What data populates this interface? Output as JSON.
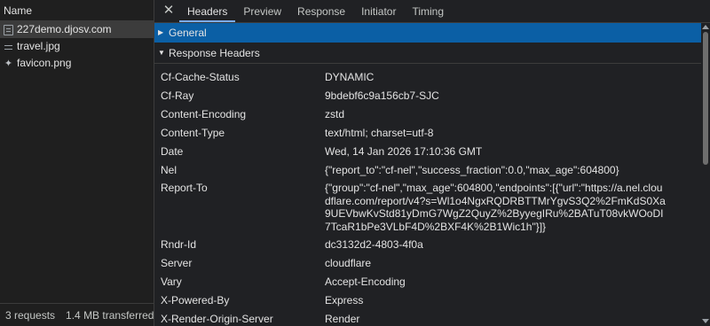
{
  "request_list": {
    "header": "Name",
    "items": [
      {
        "name": "227demo.djosv.com",
        "icon": "document-icon"
      },
      {
        "name": "travel.jpg",
        "icon": "image-icon"
      },
      {
        "name": "favicon.png",
        "icon": "favicon-icon"
      }
    ],
    "selected_index": 0
  },
  "status_bar": {
    "requests": "3 requests",
    "transferred": "1.4 MB transferred"
  },
  "tabs": {
    "close_glyph": "✕",
    "items": [
      "Headers",
      "Preview",
      "Response",
      "Initiator",
      "Timing"
    ],
    "active": "Headers"
  },
  "sections": {
    "general": {
      "label": "General",
      "expanded": false
    },
    "response_headers": {
      "label": "Response Headers",
      "expanded": true
    }
  },
  "response_headers": [
    {
      "name": "Cf-Cache-Status",
      "value": "DYNAMIC"
    },
    {
      "name": "Cf-Ray",
      "value": "9bdebf6c9a156cb7-SJC"
    },
    {
      "name": "Content-Encoding",
      "value": "zstd"
    },
    {
      "name": "Content-Type",
      "value": "text/html; charset=utf-8"
    },
    {
      "name": "Date",
      "value": "Wed, 14 Jan 2026 17:10:36 GMT"
    },
    {
      "name": "Nel",
      "value": "{\"report_to\":\"cf-nel\",\"success_fraction\":0.0,\"max_age\":604800}"
    },
    {
      "name": "Report-To",
      "value": "{\"group\":\"cf-nel\",\"max_age\":604800,\"endpoints\":[{\"url\":\"https://a.nel.cloudflare.com/report/v4?s=Wl1o4NgxRQDRBTTMrYgvS3Q2%2FmKdS0Xa9UEVbwKvStd81yDmG7WgZ2QuyZ%2ByyegIRu%2BATuT08vkWOoDI7TcaR1bPe3VLbF4D%2BXF4K%2B1Wic1h\"}]}"
    },
    {
      "name": "Rndr-Id",
      "value": "dc3132d2-4803-4f0a"
    },
    {
      "name": "Server",
      "value": "cloudflare"
    },
    {
      "name": "Vary",
      "value": "Accept-Encoding"
    },
    {
      "name": "X-Powered-By",
      "value": "Express"
    },
    {
      "name": "X-Render-Origin-Server",
      "value": "Render"
    }
  ],
  "colors": {
    "background": "#202124",
    "selected_section": "#0b5fa5",
    "active_tab_underline": "#7cacf8",
    "text": "#e3e3e3"
  }
}
